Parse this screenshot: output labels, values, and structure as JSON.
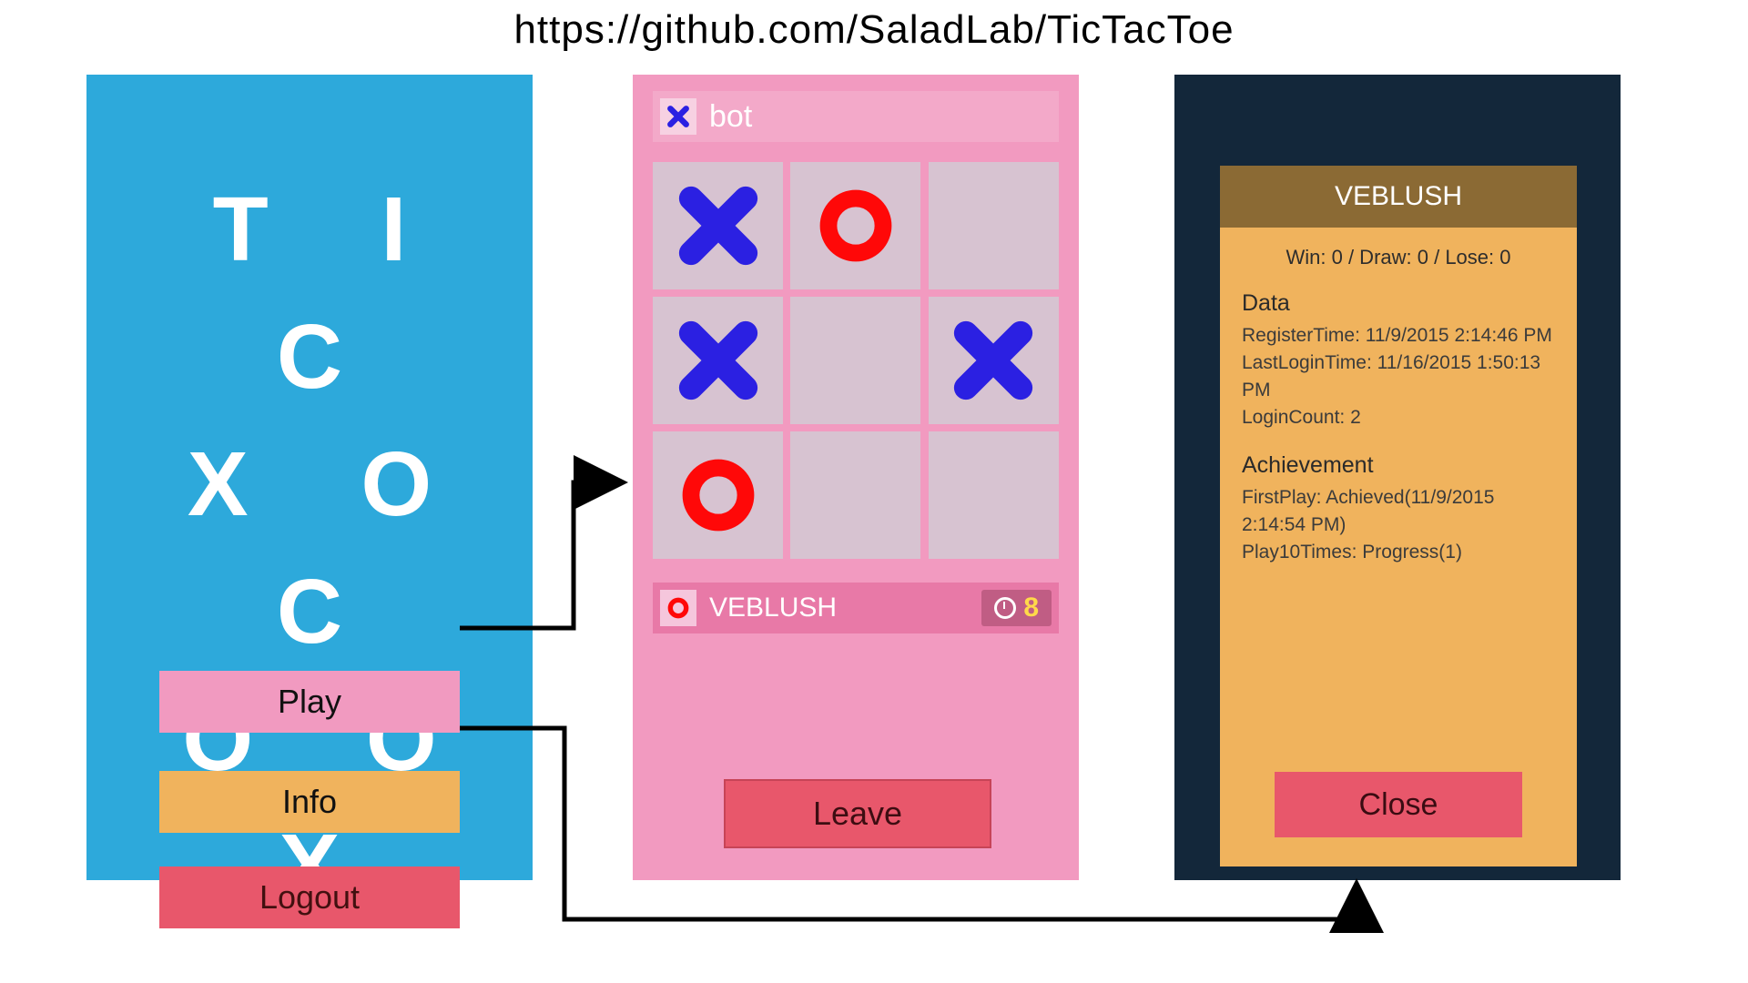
{
  "url": "https://github.com/SaladLab/TicTacToe",
  "screen1": {
    "logo_rows": [
      "T I C",
      "X O C",
      "O O X"
    ],
    "play": "Play",
    "info": "Info",
    "logout": "Logout"
  },
  "screen2": {
    "opponent": "bot",
    "opponent_mark": "X",
    "player": "VEBLUSH",
    "player_mark": "O",
    "timer": "8",
    "leave": "Leave",
    "board": [
      "X",
      "O",
      "",
      "X",
      "",
      "X",
      "O",
      "",
      ""
    ]
  },
  "screen3": {
    "header": "VEBLUSH",
    "stats_text": "Win: 0  /  Draw: 0  /  Lose: 0",
    "data_title": "Data",
    "data_lines": [
      "RegisterTime: 11/9/2015 2:14:46 PM",
      "LastLoginTime: 11/16/2015 1:50:13 PM",
      "LoginCount: 2"
    ],
    "ach_title": "Achievement",
    "ach_lines": [
      "FirstPlay: Achieved(11/9/2015 2:14:54 PM)",
      "Play10Times: Progress(1)"
    ],
    "close": "Close",
    "bg_logout": "Logout"
  },
  "colors": {
    "x": "#2b20e2",
    "o": "#ff0808"
  }
}
